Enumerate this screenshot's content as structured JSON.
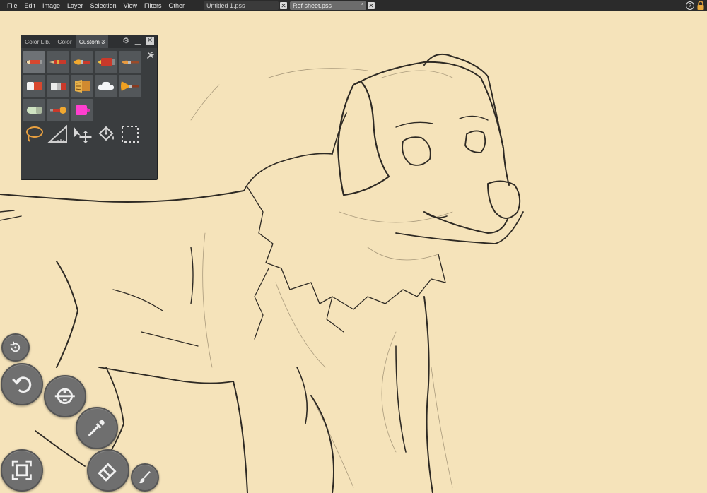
{
  "menu": [
    "File",
    "Edit",
    "Image",
    "Layer",
    "Selection",
    "View",
    "Filters",
    "Other"
  ],
  "documents": [
    {
      "name": "Untitled 1.pss",
      "modified": ""
    },
    {
      "name": "Ref sheet.pss",
      "modified": "*"
    }
  ],
  "panel": {
    "tabs": [
      "Color Lib.",
      "Color",
      "Custom 3"
    ],
    "active_tab": "Custom 3",
    "tools": [
      {
        "name": "pencil",
        "active": true
      },
      {
        "name": "technical-pen"
      },
      {
        "name": "brush"
      },
      {
        "name": "marker"
      },
      {
        "name": "fine-brush"
      },
      {
        "name": "eraser"
      },
      {
        "name": "soft-eraser"
      },
      {
        "name": "texture-brush"
      },
      {
        "name": "cloud-brush"
      },
      {
        "name": "fan-brush"
      },
      {
        "name": "blender"
      },
      {
        "name": "smudge"
      },
      {
        "name": "highlighter"
      },
      {
        "name": "lasso"
      },
      {
        "name": "ruler"
      },
      {
        "name": "move"
      },
      {
        "name": "fill"
      },
      {
        "name": "select-rectangle"
      }
    ]
  },
  "floating_tools": [
    "rotate-reset",
    "undo",
    "zoom-pan",
    "eyedropper",
    "fit-view",
    "eraser",
    "brush"
  ],
  "colors": {
    "canvas": "#f5e3ba",
    "menubar": "#2b2b2b",
    "panel": "#3a3d3f",
    "sketch": "#2e2a24"
  }
}
